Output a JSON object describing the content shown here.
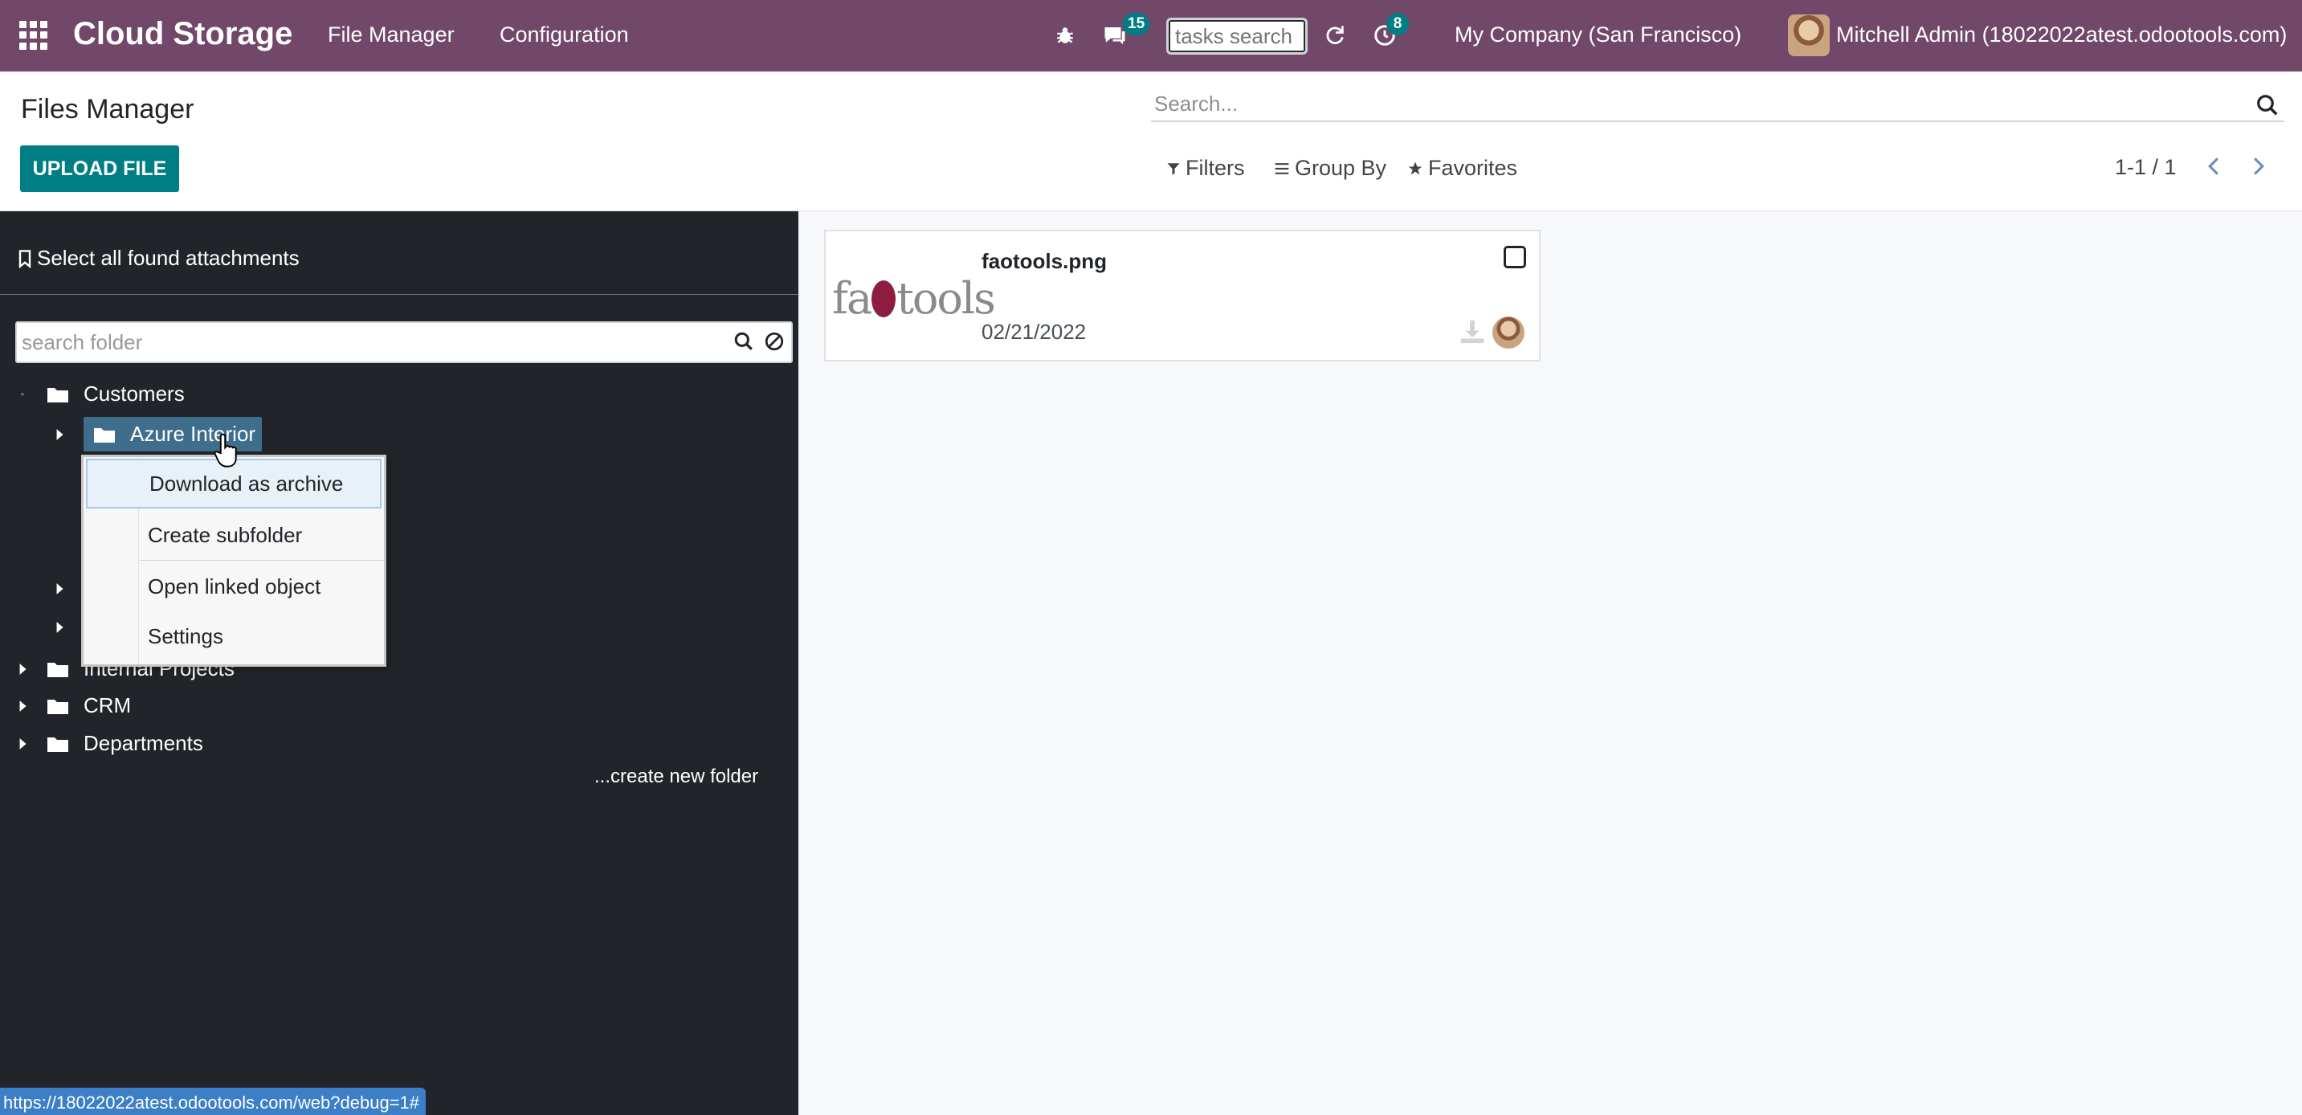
{
  "navbar": {
    "brand": "Cloud Storage",
    "menu": [
      "File Manager",
      "Configuration"
    ],
    "messages_count": "15",
    "activities_count": "8",
    "tasks_search_placeholder": "tasks search",
    "company": "My Company (San Francisco)",
    "user": "Mitchell Admin (18022022atest.odootools.com)"
  },
  "control_panel": {
    "title": "Files Manager",
    "upload_label": "UPLOAD FILE",
    "search_placeholder": "Search...",
    "filters_label": "Filters",
    "group_by_label": "Group By",
    "favorites_label": "Favorites",
    "pager": "1-1 / 1"
  },
  "left_panel": {
    "select_all": "Select all found attachments",
    "folder_search_placeholder": "search folder",
    "tree": {
      "customers": "Customers",
      "azure_interior": "Azure Interior",
      "internal_projects": "Internal Projects",
      "crm": "CRM",
      "departments": "Departments"
    },
    "create_new_folder": "...create new folder"
  },
  "context_menu": {
    "items": [
      "Download as archive",
      "Create subfolder",
      "Open linked object",
      "Settings"
    ]
  },
  "card": {
    "thumb_text_a": "fa",
    "thumb_text_b": "tools",
    "file_name": "faotools.png",
    "date": "02/21/2022"
  },
  "status_bar": {
    "url": "https://18022022atest.odootools.com/web?debug=1#"
  },
  "colors": {
    "navbar": "#71476a",
    "primary": "#017e84",
    "panel_dark": "#212529",
    "active_folder": "#3f6e8c"
  }
}
